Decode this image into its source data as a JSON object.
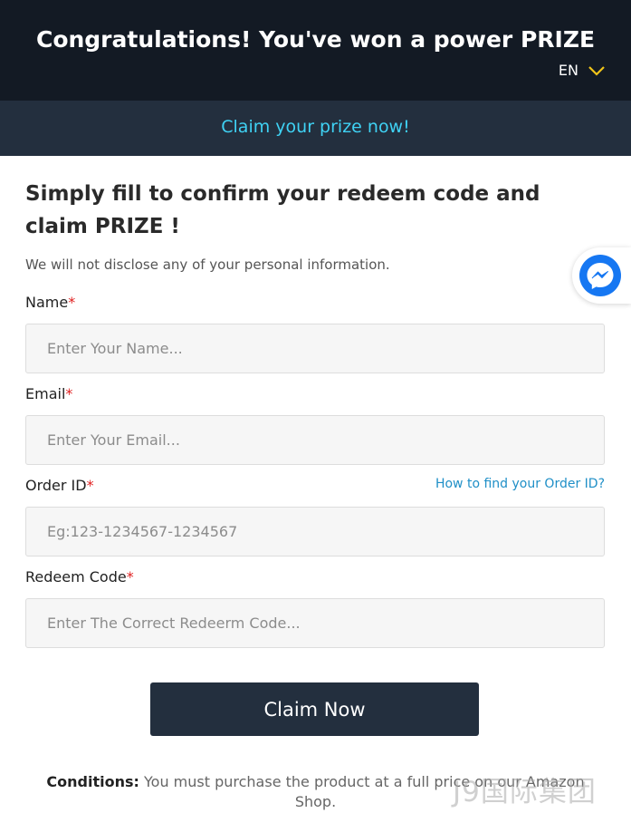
{
  "header": {
    "title": "Congratulations! You've won a power PRIZE",
    "language": "EN"
  },
  "banner": {
    "text": "Claim your prize now!"
  },
  "form": {
    "headline": "Simply fill to confirm your redeem code and claim PRIZE !",
    "privacy_note": "We will not disclose any of your personal information.",
    "required_mark": "*",
    "fields": [
      {
        "label": "Name",
        "placeholder": "Enter Your Name...",
        "value": ""
      },
      {
        "label": "Email",
        "placeholder": "Enter Your Email...",
        "value": ""
      },
      {
        "label": "Order ID",
        "placeholder": "Eg:123-1234567-1234567",
        "value": ""
      },
      {
        "label": "Redeem Code",
        "placeholder": "Enter The Correct Redeerm Code...",
        "value": ""
      }
    ],
    "order_id_help": "How to find your Order ID?",
    "submit_label": "Claim Now"
  },
  "conditions": {
    "label": "Conditions:",
    "text": " You must purchase the product at a full price on our Amazon Shop."
  },
  "watermark": "J9国际集团",
  "icons": {
    "language_dropdown": "chevron-down-icon",
    "chat": "messenger-icon"
  },
  "colors": {
    "header_bg": "#131a24",
    "banner_bg": "#232f3e",
    "banner_text": "#3fd2f4",
    "required": "#e02020",
    "link": "#1f8fc7",
    "button_bg": "#232f3e",
    "messenger": "#1677f2",
    "chevron": "#f0c419"
  }
}
